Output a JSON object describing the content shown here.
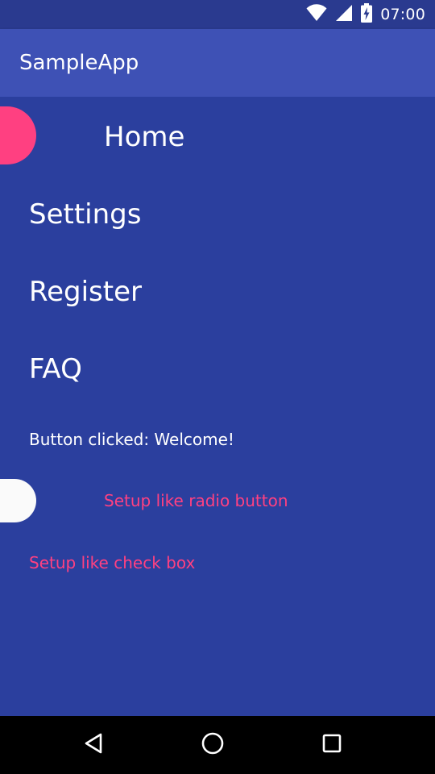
{
  "status_bar": {
    "time": "07:00",
    "icons": [
      "wifi-icon",
      "signal-icon",
      "battery-charging-icon"
    ]
  },
  "app_bar": {
    "title": "SampleApp"
  },
  "nav_menu": {
    "items": [
      {
        "label": "Home"
      },
      {
        "label": "Settings"
      },
      {
        "label": "Register"
      },
      {
        "label": "FAQ"
      }
    ]
  },
  "status_message": "Button clicked: Welcome!",
  "options": {
    "radio_label": "Setup like radio button",
    "checkbox_label": "Setup like check box"
  },
  "colors": {
    "primary": "#3e51b5",
    "primary_dark": "#2a3a8f",
    "background": "#2b3f9e",
    "accent": "#ff4081",
    "text": "#ffffff"
  },
  "system_nav": {
    "icons": [
      "back-icon",
      "home-circle-icon",
      "recents-icon"
    ]
  }
}
